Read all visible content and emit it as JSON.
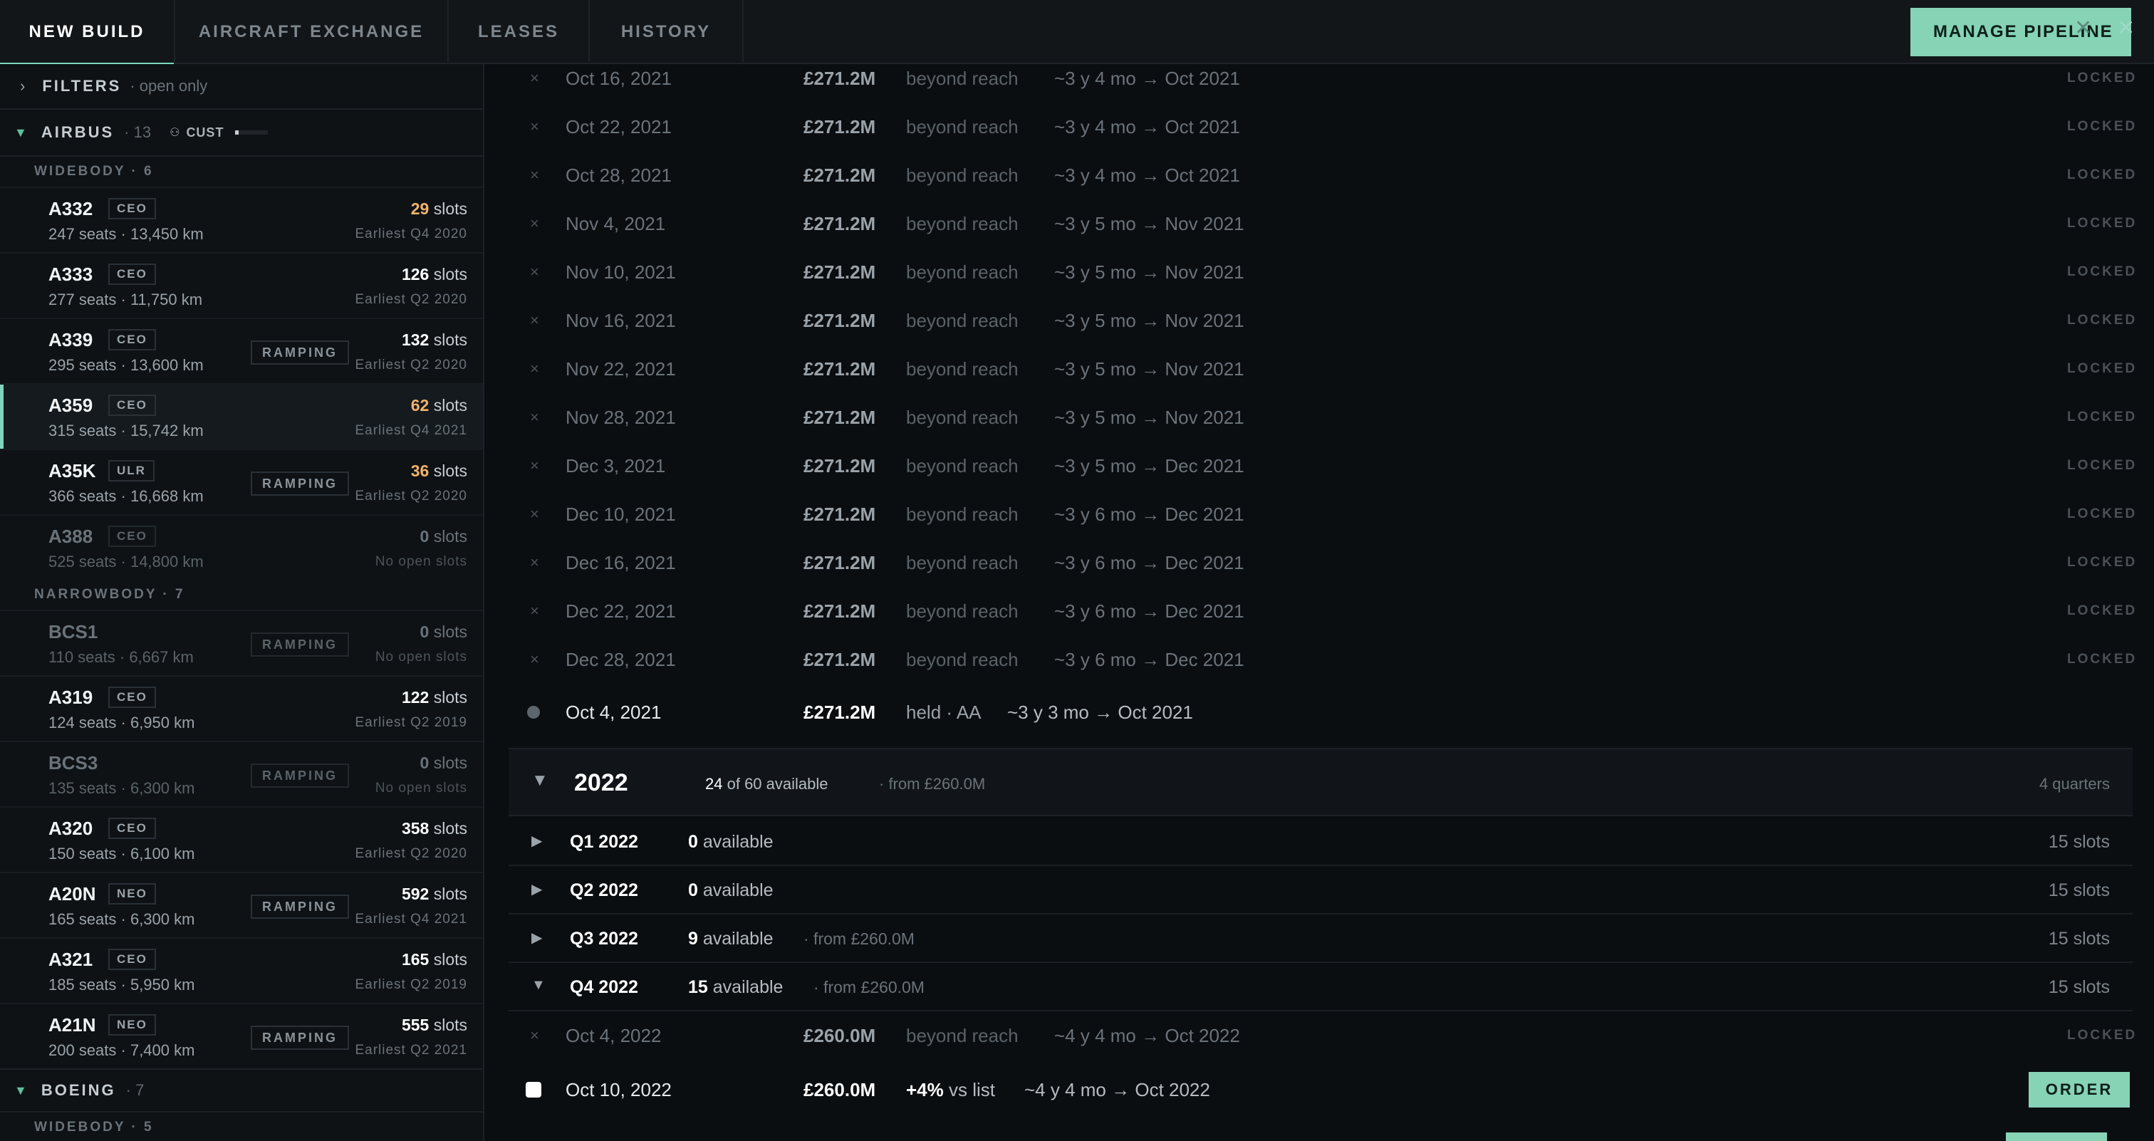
{
  "tabs": [
    {
      "label": "NEW BUILD",
      "active": true
    },
    {
      "label": "AIRCRAFT EXCHANGE"
    },
    {
      "label": "LEASES"
    },
    {
      "label": "HISTORY"
    }
  ],
  "header": {
    "manage_label": "MANAGE PIPELINE",
    "close_glyph": "✕"
  },
  "filters": {
    "chevron": "›",
    "label": "FILTERS",
    "sub": "· open only"
  },
  "airbus": {
    "name": "AIRBUS",
    "count": "· 13",
    "cust_label": "CUST",
    "cust_progress": 0.1,
    "widebody_label": "WIDEBODY · 6",
    "narrowbody_label": "NARROWBODY · 7",
    "widebody": [
      {
        "code": "A332",
        "variant": "CEO",
        "spec": "247 seats · 13,450 km",
        "ramping": false,
        "slots": "29",
        "slots_word": "slots",
        "earliest": "Earliest Q4 2020",
        "warn": true
      },
      {
        "code": "A333",
        "variant": "CEO",
        "spec": "277 seats · 11,750 km",
        "ramping": false,
        "slots": "126",
        "slots_word": "slots",
        "earliest": "Earliest Q2 2020"
      },
      {
        "code": "A339",
        "variant": "CEO",
        "spec": "295 seats · 13,600 km",
        "ramping": true,
        "ramp_label": "RAMPING",
        "slots": "132",
        "slots_word": "slots",
        "earliest": "Earliest Q2 2020"
      },
      {
        "code": "A359",
        "variant": "CEO",
        "spec": "315 seats · 15,742 km",
        "ramping": false,
        "slots": "62",
        "slots_word": "slots",
        "earliest": "Earliest Q4 2021",
        "warn": true,
        "selected": true
      },
      {
        "code": "A35K",
        "variant": "ULR",
        "spec": "366 seats · 16,668 km",
        "ramping": true,
        "ramp_label": "RAMPING",
        "slots": "36",
        "slots_word": "slots",
        "earliest": "Earliest Q2 2020",
        "warn": true
      },
      {
        "code": "A388",
        "variant": "CEO",
        "spec": "525 seats · 14,800 km",
        "ramping": false,
        "slots": "0",
        "slots_word": "slots",
        "earliest": "No open slots",
        "dim": true
      }
    ],
    "narrowbody": [
      {
        "code": "BCS1",
        "variant": "",
        "spec": "110 seats · 6,667 km",
        "ramping": true,
        "ramp_label": "RAMPING",
        "slots": "0",
        "slots_word": "slots",
        "earliest": "No open slots",
        "dim": true
      },
      {
        "code": "A319",
        "variant": "CEO",
        "spec": "124 seats · 6,950 km",
        "ramping": false,
        "slots": "122",
        "slots_word": "slots",
        "earliest": "Earliest Q2 2019"
      },
      {
        "code": "BCS3",
        "variant": "",
        "spec": "135 seats · 6,300 km",
        "ramping": true,
        "ramp_label": "RAMPING",
        "slots": "0",
        "slots_word": "slots",
        "earliest": "No open slots",
        "dim": true
      },
      {
        "code": "A320",
        "variant": "CEO",
        "spec": "150 seats · 6,100 km",
        "ramping": false,
        "slots": "358",
        "slots_word": "slots",
        "earliest": "Earliest Q2 2020"
      },
      {
        "code": "A20N",
        "variant": "NEO",
        "spec": "165 seats · 6,300 km",
        "ramping": true,
        "ramp_label": "RAMPING",
        "slots": "592",
        "slots_word": "slots",
        "earliest": "Earliest Q4 2021"
      },
      {
        "code": "A321",
        "variant": "CEO",
        "spec": "185 seats · 5,950 km",
        "ramping": false,
        "slots": "165",
        "slots_word": "slots",
        "earliest": "Earliest Q2 2019"
      },
      {
        "code": "A21N",
        "variant": "NEO",
        "spec": "200 seats · 7,400 km",
        "ramping": true,
        "ramp_label": "RAMPING",
        "slots": "555",
        "slots_word": "slots",
        "earliest": "Earliest Q2 2021"
      }
    ]
  },
  "boeing": {
    "name": "BOEING",
    "count": "· 7",
    "widebody_label": "WIDEBODY · 5"
  },
  "locked_slots": [
    {
      "date": "Oct 16, 2021",
      "price": "£271.2M",
      "status": "beyond reach",
      "eta": "~3 y 4 mo → Oct 2021",
      "tag": "LOCKED"
    },
    {
      "date": "Oct 22, 2021",
      "price": "£271.2M",
      "status": "beyond reach",
      "eta": "~3 y 4 mo → Oct 2021",
      "tag": "LOCKED"
    },
    {
      "date": "Oct 28, 2021",
      "price": "£271.2M",
      "status": "beyond reach",
      "eta": "~3 y 4 mo → Oct 2021",
      "tag": "LOCKED"
    },
    {
      "date": "Nov 4, 2021",
      "price": "£271.2M",
      "status": "beyond reach",
      "eta": "~3 y 5 mo → Nov 2021",
      "tag": "LOCKED"
    },
    {
      "date": "Nov 10, 2021",
      "price": "£271.2M",
      "status": "beyond reach",
      "eta": "~3 y 5 mo → Nov 2021",
      "tag": "LOCKED"
    },
    {
      "date": "Nov 16, 2021",
      "price": "£271.2M",
      "status": "beyond reach",
      "eta": "~3 y 5 mo → Nov 2021",
      "tag": "LOCKED"
    },
    {
      "date": "Nov 22, 2021",
      "price": "£271.2M",
      "status": "beyond reach",
      "eta": "~3 y 5 mo → Nov 2021",
      "tag": "LOCKED"
    },
    {
      "date": "Nov 28, 2021",
      "price": "£271.2M",
      "status": "beyond reach",
      "eta": "~3 y 5 mo → Nov 2021",
      "tag": "LOCKED"
    },
    {
      "date": "Dec 3, 2021",
      "price": "£271.2M",
      "status": "beyond reach",
      "eta": "~3 y 5 mo → Dec 2021",
      "tag": "LOCKED"
    },
    {
      "date": "Dec 10, 2021",
      "price": "£271.2M",
      "status": "beyond reach",
      "eta": "~3 y 6 mo → Dec 2021",
      "tag": "LOCKED"
    },
    {
      "date": "Dec 16, 2021",
      "price": "£271.2M",
      "status": "beyond reach",
      "eta": "~3 y 6 mo → Dec 2021",
      "tag": "LOCKED"
    },
    {
      "date": "Dec 22, 2021",
      "price": "£271.2M",
      "status": "beyond reach",
      "eta": "~3 y 6 mo → Dec 2021",
      "tag": "LOCKED"
    },
    {
      "date": "Dec 28, 2021",
      "price": "£271.2M",
      "status": "beyond reach",
      "eta": "~3 y 6 mo → Dec 2021",
      "tag": "LOCKED"
    }
  ],
  "held_slot": {
    "date": "Oct 4, 2021",
    "price": "£271.2M",
    "status": "held · AA",
    "eta": "~3 y 3 mo → Oct 2021"
  },
  "year_2022": {
    "year": "2022",
    "available_count": "24",
    "available_text": "of 60 available",
    "from": "· from £260.0M",
    "quarters": "4 quarters"
  },
  "quarter_rows": [
    {
      "name": "Q1 2022",
      "avail": "0",
      "avail_word": "available",
      "from": "",
      "slots": "15 slots",
      "expanded": false
    },
    {
      "name": "Q2 2022",
      "avail": "0",
      "avail_word": "available",
      "from": "",
      "slots": "15 slots",
      "expanded": false
    },
    {
      "name": "Q3 2022",
      "avail": "9",
      "avail_word": "available",
      "from": "· from £260.0M",
      "slots": "15 slots",
      "expanded": false
    },
    {
      "name": "Q4 2022",
      "avail": "15",
      "avail_word": "available",
      "from": "· from £260.0M",
      "slots": "15 slots",
      "expanded": true
    }
  ],
  "q4_locked": {
    "date": "Oct 4, 2022",
    "price": "£260.0M",
    "status": "beyond reach",
    "eta": "~4 y 4 mo → Oct 2022",
    "tag": "LOCKED"
  },
  "q4_order": {
    "date": "Oct 10, 2022",
    "price": "£260.0M",
    "pct": "+4%",
    "pct_word": "vs list",
    "eta": "~4 y 4 mo → Oct 2022",
    "button": "ORDER"
  },
  "glyphs": {
    "x": "×",
    "tri_down": "▼",
    "tri_right": "▶",
    "person": "⚇"
  }
}
